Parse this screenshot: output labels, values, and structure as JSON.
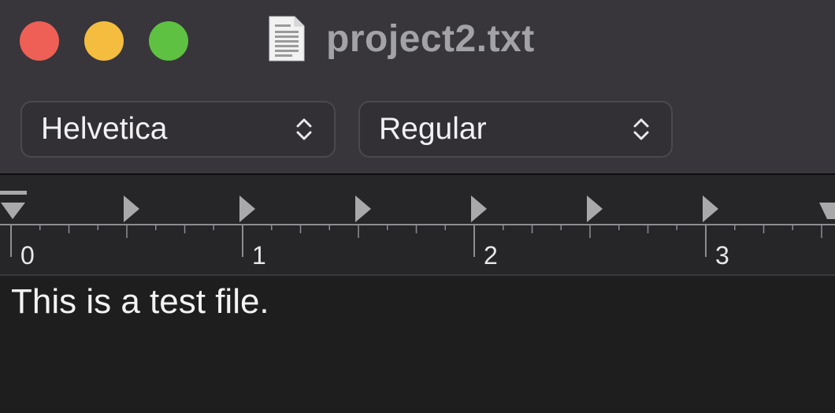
{
  "window": {
    "title": "project2.txt",
    "document_icon": "text-document-icon"
  },
  "traffic_lights": [
    {
      "name": "close",
      "color": "#ee5f56"
    },
    {
      "name": "minimize",
      "color": "#f5bd3f"
    },
    {
      "name": "zoom",
      "color": "#5ec142"
    }
  ],
  "toolbar": {
    "font_family": {
      "value": "Helvetica",
      "icon": "chevron-up-down-icon"
    },
    "font_style": {
      "value": "Regular",
      "icon": "chevron-up-down-icon"
    }
  },
  "ruler": {
    "numbers": [
      "0",
      "1",
      "2",
      "3"
    ]
  },
  "editor": {
    "content": "This is a test file."
  }
}
